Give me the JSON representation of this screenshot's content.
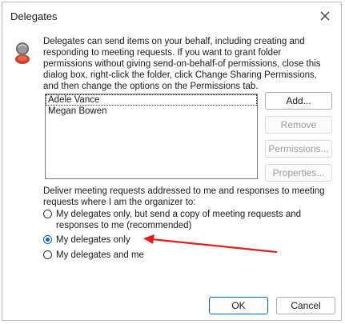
{
  "window": {
    "title": "Delegates",
    "close_icon": "close-icon"
  },
  "intro_text": "Delegates can send items on your behalf, including creating and responding to meeting requests. If you want to grant folder permissions without giving send-on-behalf-of permissions, close this dialog box, right-click the folder, click Change Sharing Permissions, and then change the options on the Permissions tab.",
  "delegates": [
    {
      "name": "Adele Vance"
    },
    {
      "name": "Megan Bowen"
    }
  ],
  "buttons": {
    "add": "Add...",
    "remove": "Remove",
    "permissions": "Permissions...",
    "properties": "Properties...",
    "ok": "OK",
    "cancel": "Cancel"
  },
  "deliver": {
    "label": "Deliver meeting requests addressed to me and responses to meeting requests where I am the organizer to:",
    "options": [
      {
        "label": "My delegates only, but send a copy of meeting requests and responses to me (recommended)",
        "selected": false
      },
      {
        "label": "My delegates only",
        "selected": true
      },
      {
        "label": "My delegates and me",
        "selected": false
      }
    ]
  },
  "colors": {
    "accent": "#0067c0",
    "annotation_arrow": "#e0201b"
  }
}
